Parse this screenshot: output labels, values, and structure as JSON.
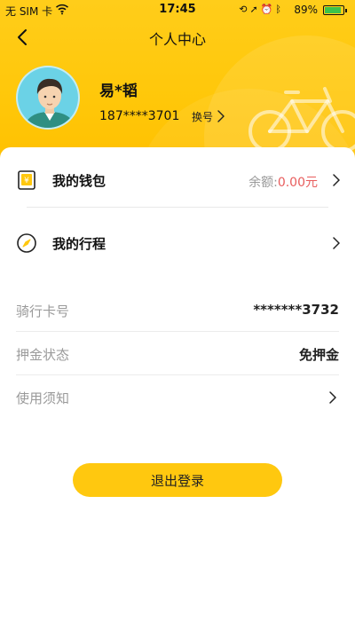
{
  "status_bar": {
    "carrier": "无 SIM 卡",
    "time": "17:45",
    "battery": "89%",
    "battery_level": 0.89,
    "icons": [
      "wifi-icon",
      "orientation-lock-icon",
      "location-icon",
      "alarm-icon",
      "bluetooth-icon",
      "battery-icon"
    ]
  },
  "nav": {
    "title": "个人中心",
    "back_icon": "chevron-left-icon"
  },
  "profile": {
    "name": "易*韬",
    "phone": "187****3701",
    "change_number_label": "换号",
    "avatar_icon": "user-avatar-icon"
  },
  "menu": {
    "wallet": {
      "label": "我的钱包",
      "balance_label": "余额:",
      "balance_value": "0.00元",
      "icon": "wallet-icon"
    },
    "trips": {
      "label": "我的行程",
      "icon": "compass-icon"
    }
  },
  "info": {
    "card_number": {
      "label": "骑行卡号",
      "value": "*******3732"
    },
    "deposit_status": {
      "label": "押金状态",
      "value": "免押金"
    },
    "usage_notice": {
      "label": "使用须知"
    }
  },
  "logout_label": "退出登录",
  "colors": {
    "accent": "#ffc80f",
    "balance": "#e85d5d",
    "muted": "#9a9a9a"
  }
}
